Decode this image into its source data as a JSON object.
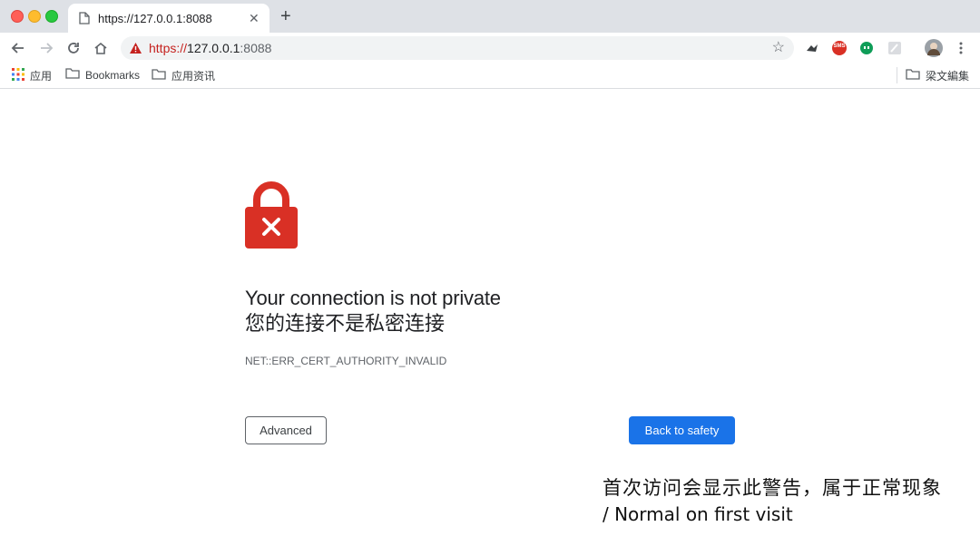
{
  "tab": {
    "title": "https://127.0.0.1:8088",
    "icon": "document-icon",
    "close_label": "✕"
  },
  "newtab_label": "+",
  "omnibox": {
    "scheme": "https://",
    "host": "127.0.0.1",
    "port": ":8088",
    "security_icon": "warning-triangle-icon",
    "star_label": "☆"
  },
  "extensions": {
    "sms_label": "SMS"
  },
  "bookmarks": {
    "apps_label": "应用",
    "items": [
      {
        "label": "Bookmarks"
      },
      {
        "label": "应用资讯"
      }
    ],
    "other_label": "梁文編集"
  },
  "interstitial": {
    "title": "Your connection is not private",
    "title_cn": "您的连接不是私密连接",
    "error_code": "NET::ERR_CERT_AUTHORITY_INVALID",
    "advanced_label": "Advanced",
    "back_label": "Back to safety"
  },
  "annotation": {
    "line1": "首次访问会显示此警告，属于正常现象",
    "line2": "/ Normal on first visit"
  },
  "colors": {
    "accent": "#1a73e8",
    "danger": "#c5221f",
    "lock": "#d93025",
    "tabstrip": "#dee1e6"
  }
}
